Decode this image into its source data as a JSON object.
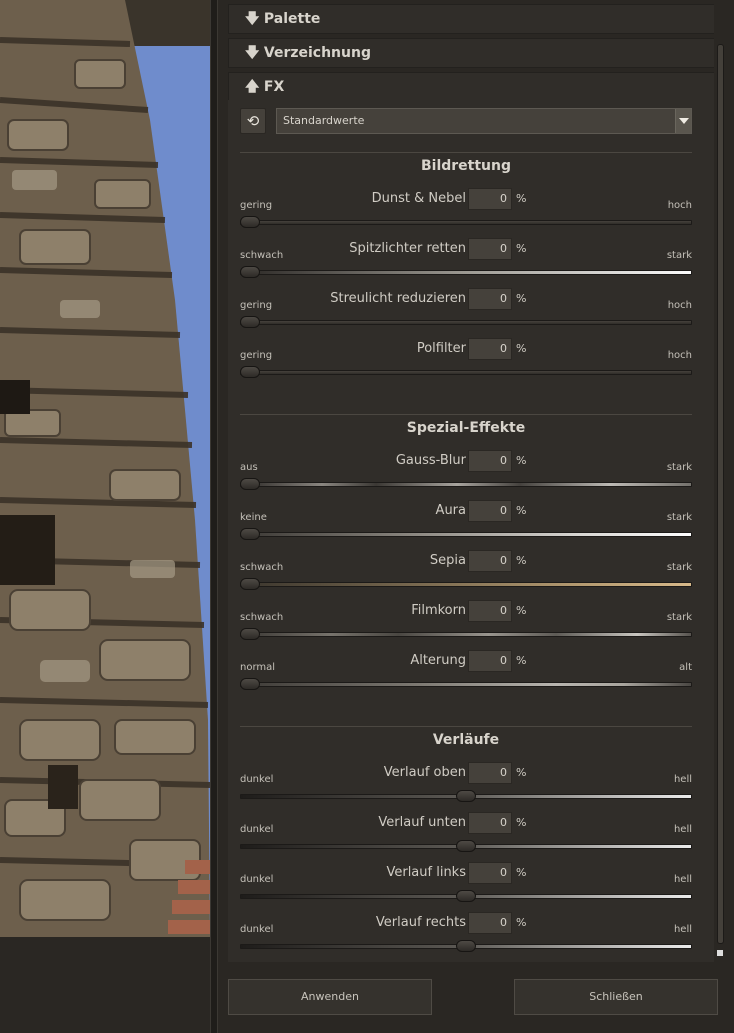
{
  "sections": {
    "palette": {
      "arrow": "🡇",
      "label": "Palette"
    },
    "distortion": {
      "arrow": "🡇",
      "label": "Verzeichnung"
    },
    "fx": {
      "arrow": "🡅",
      "label": "FX"
    }
  },
  "preset": {
    "reset_icon": "⟲",
    "value": "Standardwerte"
  },
  "groups": {
    "rescue": "Bildrettung",
    "special": "Spezial-Effekte",
    "gradients": "Verläufe"
  },
  "sliders": {
    "haze": {
      "label": "Dunst & Nebel",
      "value": "0",
      "unit": "%",
      "min": "gering",
      "max": "hoch",
      "position": 0
    },
    "highlights": {
      "label": "Spitzlichter retten",
      "value": "0",
      "unit": "%",
      "min": "schwach",
      "max": "stark",
      "position": 0
    },
    "straylight": {
      "label": "Streulicht reduzieren",
      "value": "0",
      "unit": "%",
      "min": "gering",
      "max": "hoch",
      "position": 0
    },
    "polfilter": {
      "label": "Polfilter",
      "value": "0",
      "unit": "%",
      "min": "gering",
      "max": "hoch",
      "position": 0
    },
    "gauss": {
      "label": "Gauss-Blur",
      "value": "0",
      "unit": "%",
      "min": "aus",
      "max": "stark",
      "position": 0
    },
    "aura": {
      "label": "Aura",
      "value": "0",
      "unit": "%",
      "min": "keine",
      "max": "stark",
      "position": 0
    },
    "sepia": {
      "label": "Sepia",
      "value": "0",
      "unit": "%",
      "min": "schwach",
      "max": "stark",
      "position": 0
    },
    "grain": {
      "label": "Filmkorn",
      "value": "0",
      "unit": "%",
      "min": "schwach",
      "max": "stark",
      "position": 0
    },
    "aging": {
      "label": "Alterung",
      "value": "0",
      "unit": "%",
      "min": "normal",
      "max": "alt",
      "position": 0
    },
    "grad_top": {
      "label": "Verlauf oben",
      "value": "0",
      "unit": "%",
      "min": "dunkel",
      "max": "hell",
      "position": 0.5
    },
    "grad_bottom": {
      "label": "Verlauf unten",
      "value": "0",
      "unit": "%",
      "min": "dunkel",
      "max": "hell",
      "position": 0.5
    },
    "grad_left": {
      "label": "Verlauf links",
      "value": "0",
      "unit": "%",
      "min": "dunkel",
      "max": "hell",
      "position": 0.5
    },
    "grad_right": {
      "label": "Verlauf rechts",
      "value": "0",
      "unit": "%",
      "min": "dunkel",
      "max": "hell",
      "position": 0.5
    }
  },
  "buttons": {
    "apply": "Anwenden",
    "close": "Schließen"
  },
  "colors": {
    "panel_bg": "#2a2723",
    "section_bg": "#302d29",
    "text": "#d8d4cc",
    "sky": "#6f8ccc"
  }
}
